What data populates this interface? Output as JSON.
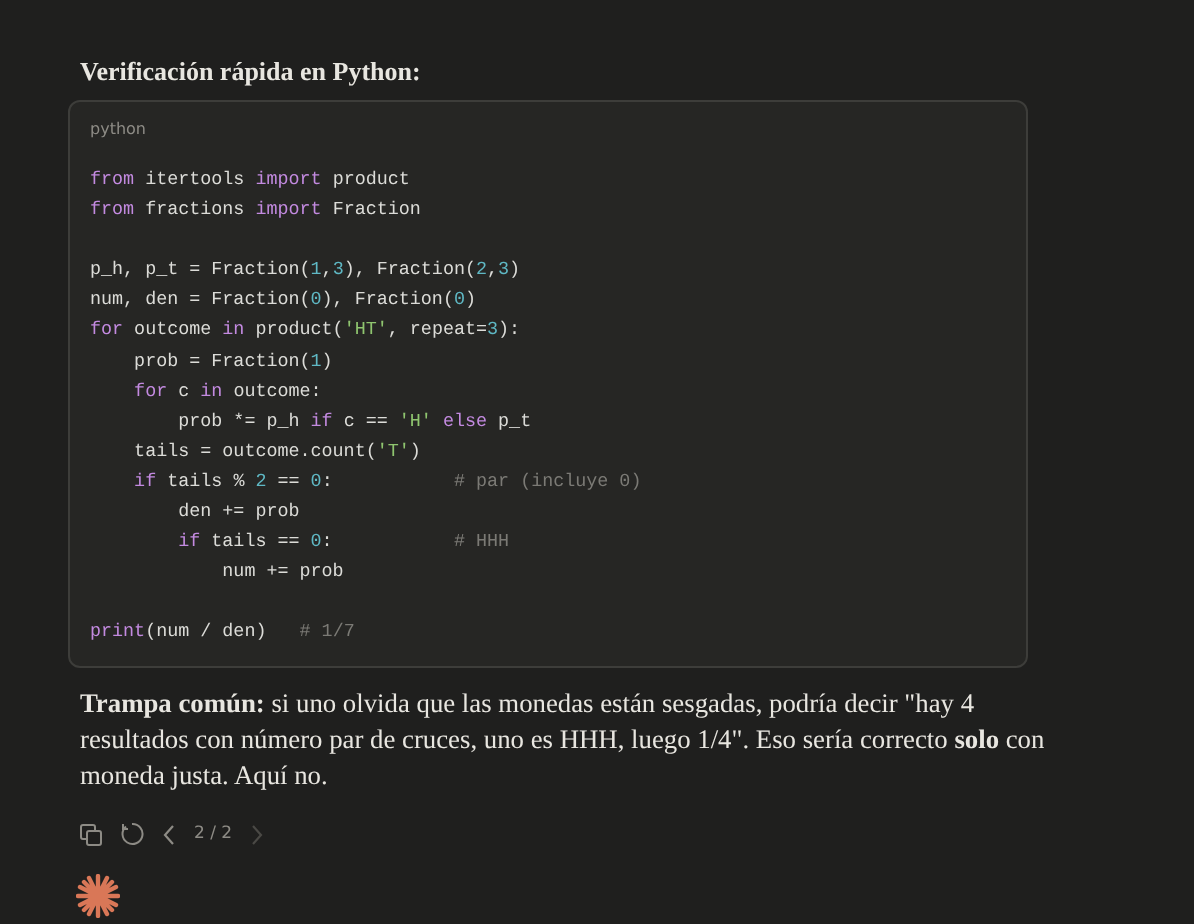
{
  "heading": "Verificación rápida en Python:",
  "code_block": {
    "language": "python",
    "groups": [
      [
        [
          {
            "kind": "keyword",
            "text": "from"
          },
          {
            "kind": "plain",
            "text": " itertools "
          },
          {
            "kind": "keyword",
            "text": "import"
          },
          {
            "kind": "plain",
            "text": " product"
          }
        ],
        [
          {
            "kind": "keyword",
            "text": "from"
          },
          {
            "kind": "plain",
            "text": " fractions "
          },
          {
            "kind": "keyword",
            "text": "import"
          },
          {
            "kind": "plain",
            "text": " Fraction"
          }
        ]
      ],
      [
        [
          {
            "kind": "plain",
            "text": "p_h, p_t = Fraction("
          },
          {
            "kind": "number",
            "text": "1"
          },
          {
            "kind": "plain",
            "text": ","
          },
          {
            "kind": "number",
            "text": "3"
          },
          {
            "kind": "plain",
            "text": "), Fraction("
          },
          {
            "kind": "number",
            "text": "2"
          },
          {
            "kind": "plain",
            "text": ","
          },
          {
            "kind": "number",
            "text": "3"
          },
          {
            "kind": "plain",
            "text": ")"
          }
        ],
        [
          {
            "kind": "plain",
            "text": "num, den = Fraction("
          },
          {
            "kind": "number",
            "text": "0"
          },
          {
            "kind": "plain",
            "text": "), Fraction("
          },
          {
            "kind": "number",
            "text": "0"
          },
          {
            "kind": "plain",
            "text": ")"
          }
        ],
        [
          {
            "kind": "keyword",
            "text": "for"
          },
          {
            "kind": "plain",
            "text": " outcome "
          },
          {
            "kind": "keyword",
            "text": "in"
          },
          {
            "kind": "plain",
            "text": " product("
          },
          {
            "kind": "string",
            "text": "'HT'"
          },
          {
            "kind": "plain",
            "text": ", repeat="
          },
          {
            "kind": "number",
            "text": "3"
          },
          {
            "kind": "plain",
            "text": "):"
          }
        ],
        [
          {
            "kind": "plain",
            "text": "    prob = Fraction("
          },
          {
            "kind": "number",
            "text": "1"
          },
          {
            "kind": "plain",
            "text": ")"
          }
        ],
        [
          {
            "kind": "keyword",
            "text": "    for"
          },
          {
            "kind": "plain",
            "text": " c "
          },
          {
            "kind": "keyword",
            "text": "in"
          },
          {
            "kind": "plain",
            "text": " outcome:"
          }
        ],
        [
          {
            "kind": "plain",
            "text": "        prob *= p_h "
          },
          {
            "kind": "keyword",
            "text": "if"
          },
          {
            "kind": "plain",
            "text": " c == "
          },
          {
            "kind": "string",
            "text": "'H'"
          },
          {
            "kind": "keyword",
            "text": " else"
          },
          {
            "kind": "plain",
            "text": " p_t"
          }
        ],
        [
          {
            "kind": "plain",
            "text": "    tails = outcome.count("
          },
          {
            "kind": "string",
            "text": "'T'"
          },
          {
            "kind": "plain",
            "text": ")"
          }
        ],
        [
          {
            "kind": "keyword",
            "text": "    if"
          },
          {
            "kind": "plain",
            "text": " tails % "
          },
          {
            "kind": "number",
            "text": "2"
          },
          {
            "kind": "plain",
            "text": " == "
          },
          {
            "kind": "number",
            "text": "0"
          },
          {
            "kind": "plain",
            "text": ":           "
          },
          {
            "kind": "comment",
            "text": "# par (incluye 0)"
          }
        ],
        [
          {
            "kind": "plain",
            "text": "        den += prob"
          }
        ],
        [
          {
            "kind": "keyword",
            "text": "        if"
          },
          {
            "kind": "plain",
            "text": " tails == "
          },
          {
            "kind": "number",
            "text": "0"
          },
          {
            "kind": "plain",
            "text": ":           "
          },
          {
            "kind": "comment",
            "text": "# HHH"
          }
        ],
        [
          {
            "kind": "plain",
            "text": "            num += prob"
          }
        ]
      ],
      [
        [
          {
            "kind": "keyword",
            "text": "print"
          },
          {
            "kind": "plain",
            "text": "(num / den)   "
          },
          {
            "kind": "comment",
            "text": "# 1/7"
          }
        ]
      ]
    ]
  },
  "note": "**Trampa común:** si uno olvida que las monedas están sesgadas, podría decir \"hay 4 resultados con número par de cruces, uno es HHH, luego 1/4\". Eso sería correcto **solo** con moneda justa. Aquí no.",
  "actions": {
    "pager": "2 / 2",
    "previous_disabled": false,
    "next_disabled": true
  }
}
